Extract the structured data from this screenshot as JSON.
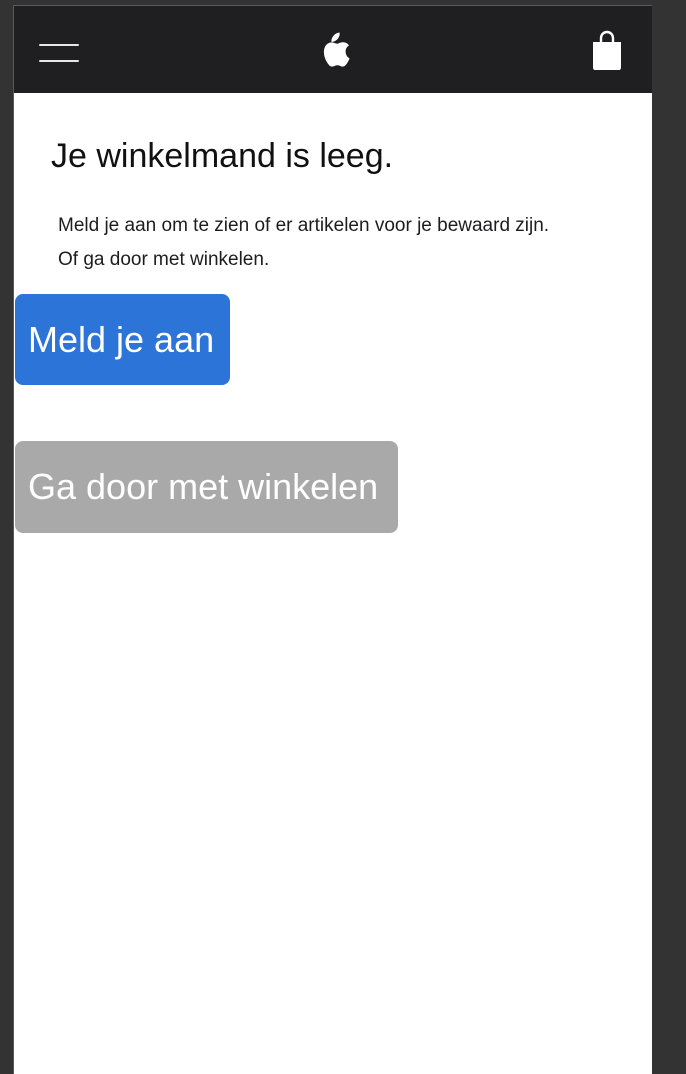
{
  "header": {
    "menu_icon": "hamburger-menu-icon",
    "logo_icon": "apple-logo-icon",
    "bag_icon": "shopping-bag-icon",
    "background_color": "#1f1f21"
  },
  "main": {
    "title": "Je winkelmand is leeg.",
    "message_line1": "Meld je aan om te zien of er artikelen voor je bewaard zijn.",
    "message_line2": "Of ga door met winkelen."
  },
  "buttons": {
    "sign_in_label": "Meld je aan",
    "sign_in_color": "#2c74d8",
    "continue_label": "Ga door met winkelen",
    "continue_color": "#a9a9a9"
  }
}
